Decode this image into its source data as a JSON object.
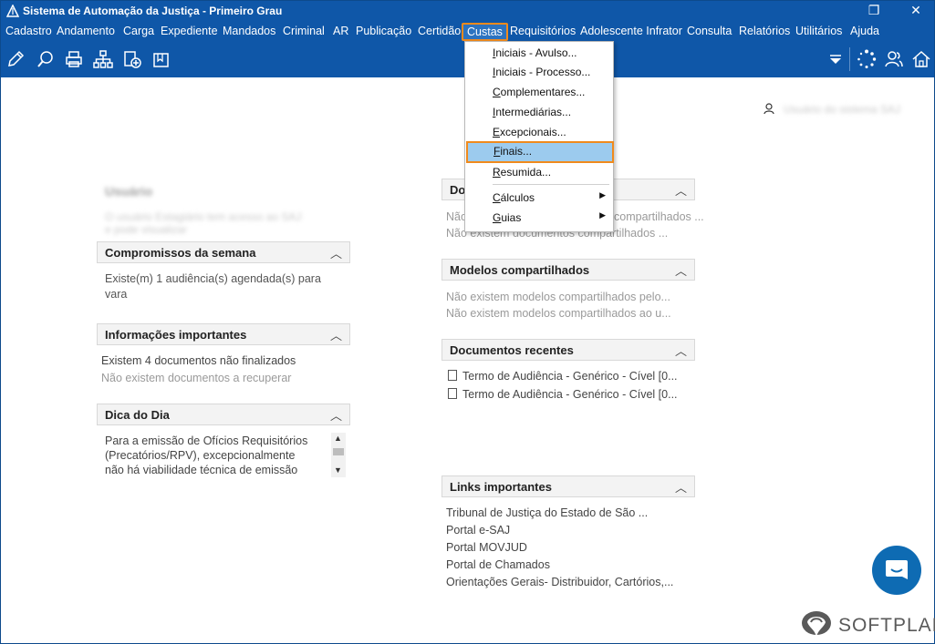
{
  "window": {
    "title": "Sistema de Automação da Justiça - Primeiro Grau",
    "restore_glyph": "❐",
    "close_glyph": "✕"
  },
  "menubar": {
    "items": [
      "Cadastro",
      "Andamento",
      "Carga",
      "Expediente",
      "Mandados",
      "Criminal",
      "AR",
      "Publicação",
      "Certidão",
      "Custas",
      "Requisitórios",
      "Adolescente Infrator",
      "Consulta",
      "Relatórios",
      "Utilitários",
      "Ajuda"
    ],
    "active": "Custas"
  },
  "toolbar": {
    "icons": [
      "edit-icon",
      "search-icon",
      "print-icon",
      "hierarchy-icon",
      "add-document-icon",
      "folder-icon"
    ],
    "right_icons": [
      "dropdown-icon",
      "loading-icon",
      "users-icon",
      "home-icon"
    ]
  },
  "custas_menu": {
    "items": [
      {
        "label": "Iniciais - Avulso...",
        "underline": "I",
        "rest": "niciais - Avulso..."
      },
      {
        "label": "Iniciais - Processo...",
        "underline": "I",
        "rest": "niciais - Processo..."
      },
      {
        "label": "Complementares...",
        "underline": "C",
        "rest": "omplementares..."
      },
      {
        "label": "Intermediárias...",
        "underline": "I",
        "rest": "ntermediárias..."
      },
      {
        "label": "Excepcionais...",
        "underline": "E",
        "rest": "xcepcionais..."
      },
      {
        "label": "Finais...",
        "underline": "F",
        "rest": "inais..."
      },
      {
        "label": "Resumida...",
        "underline": "R",
        "rest": "esumida..."
      },
      {
        "label": "Cálculos",
        "underline": "C",
        "rest": "álculos"
      },
      {
        "label": "Guias",
        "underline": "G",
        "rest": "uias"
      }
    ],
    "selected": "Finais..."
  },
  "user": {
    "name_blurred": "Usuário do sistema SAJ"
  },
  "left": {
    "blurred_title": "Usuário",
    "blurred_line1": "O usuário Estagiário tem acesso ao SAJ",
    "blurred_line2": "e pode visualizar",
    "compromissos": {
      "title": "Compromissos da semana",
      "line1": "Existe(m) 1 audiência(s) agendada(s) para",
      "line2": "vara"
    },
    "informacoes": {
      "title": "Informações importantes",
      "line1": "Existem 4 documentos não finalizados",
      "line2": "Não existem documentos a recuperar"
    },
    "dica": {
      "title": "Dica do Dia",
      "line1": "Para a emissão de Ofícios Requisitórios",
      "line2": "(Precatórios/RPV), excepcionalmente",
      "line3": "não há viabilidade técnica de emissão"
    }
  },
  "right": {
    "documentos": {
      "title": "Do",
      "line1": "Não",
      "line1_rest": "compartilhados ...",
      "line2": "Não existem documentos compartilhados ..."
    },
    "modelos": {
      "title": "Modelos compartilhados",
      "line1": "Não existem modelos compartilhados pelo...",
      "line2": "Não existem modelos compartilhados ao u..."
    },
    "recentes": {
      "title": "Documentos recentes",
      "items": [
        "Termo de Audiência - Genérico - Cível [0...",
        "Termo de Audiência - Genérico - Cível [0..."
      ]
    },
    "links": {
      "title": "Links importantes",
      "items": [
        "Tribunal de Justiça do Estado de São ...",
        "Portal e-SAJ",
        "Portal MOVJUD",
        "Portal de Chamados",
        "Orientações Gerais- Distribuidor, Cartórios,..."
      ]
    }
  },
  "brand": {
    "name": "SOFTPLAN"
  },
  "colors": {
    "titlebar": "#0f57a8",
    "highlight": "#f08a1c",
    "selection": "#9ccbee"
  }
}
